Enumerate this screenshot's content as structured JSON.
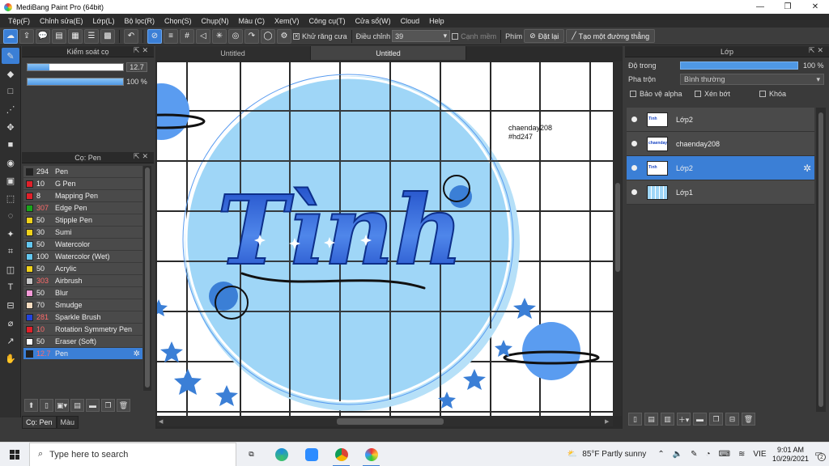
{
  "window": {
    "title": "MediBang Paint Pro (64bit)",
    "controls": [
      "—",
      "❐",
      "✕"
    ]
  },
  "menu": [
    "Tệp(F)",
    "Chỉnh sửa(E)",
    "Lớp(L)",
    "Bộ lọc(R)",
    "Chọn(S)",
    "Chụp(N)",
    "Màu (C)",
    "Xem(V)",
    "Công cụ(T)",
    "Cửa sổ(W)",
    "Cloud",
    "Help"
  ],
  "toolbar": {
    "antialias_label": "Khử răng cưa",
    "correction_label": "Điều chỉnh",
    "correction_value": "39",
    "smooth_edge_label": "Cạnh mềm",
    "key_label": "Phím",
    "reset_label": "Đặt lại",
    "straight_line_label": "Tạo một đường thẳng"
  },
  "brush_control": {
    "title": "Kiểm soát cọ",
    "size_value": "12.7",
    "size_fraction": 0.23,
    "opacity_value": "100 %",
    "opacity_fraction": 1.0
  },
  "brush_panel": {
    "title": "Cọ: Pen",
    "brushes": [
      {
        "size": "294",
        "name": "Pen",
        "color": "#222222",
        "size_red": false
      },
      {
        "size": "10",
        "name": "G Pen",
        "color": "#e0202a",
        "size_red": false
      },
      {
        "size": "8",
        "name": "Mapping Pen",
        "color": "#e0202a",
        "size_red": false
      },
      {
        "size": "307",
        "name": "Edge Pen",
        "color": "#1aa51a",
        "size_red": true
      },
      {
        "size": "50",
        "name": "Stipple Pen",
        "color": "#f0d21a",
        "size_red": false
      },
      {
        "size": "30",
        "name": "Sumi",
        "color": "#f0d21a",
        "size_red": false
      },
      {
        "size": "50",
        "name": "Watercolor",
        "color": "#63c7f0",
        "size_red": false
      },
      {
        "size": "100",
        "name": "Watercolor (Wet)",
        "color": "#63c7f0",
        "size_red": false
      },
      {
        "size": "50",
        "name": "Acrylic",
        "color": "#f0d21a",
        "size_red": false
      },
      {
        "size": "303",
        "name": "Airbrush",
        "color": "#c8c8c8",
        "size_red": true
      },
      {
        "size": "50",
        "name": "Blur",
        "color": "#f59ad8",
        "size_red": false
      },
      {
        "size": "70",
        "name": "Smudge",
        "color": "#f6dcc0",
        "size_red": false
      },
      {
        "size": "281",
        "name": "Sparkle Brush",
        "color": "#2244dd",
        "size_red": true
      },
      {
        "size": "10",
        "name": "Rotation Symmetry Pen",
        "color": "#e0202a",
        "size_red": true
      },
      {
        "size": "50",
        "name": "Eraser (Soft)",
        "color": "#ffffff",
        "size_red": false
      },
      {
        "size": "12.7",
        "name": "Pen",
        "color": "#222222",
        "size_red": true,
        "selected": true
      }
    ]
  },
  "bottom_tabs": [
    "Cọ: Pen",
    "Màu"
  ],
  "doc_tabs": [
    "Untitled",
    "Untitled"
  ],
  "canvas": {
    "lettering": "Tình",
    "caption_line1": "chaenday208",
    "caption_line2": "#hd247"
  },
  "layer_panel": {
    "title": "Lớp",
    "opacity_label": "Độ trong",
    "opacity_value": "100 %",
    "blend_label": "Pha trộn",
    "blend_value": "Bình thường",
    "protect_alpha": "Bảo vệ alpha",
    "clipping": "Xén bớt",
    "lock": "Khóa",
    "layers": [
      {
        "name": "Lớp2",
        "selected": false,
        "thumb_text": "Tình"
      },
      {
        "name": "chaenday208",
        "selected": false,
        "thumb_text": "chaenday208"
      },
      {
        "name": "Lớp2",
        "selected": true,
        "thumb_text": "Tình"
      },
      {
        "name": "Lớp1",
        "selected": false,
        "thumb_text": ""
      }
    ]
  },
  "taskbar": {
    "search_placeholder": "Type here to search",
    "weather": "85°F  Partly sunny",
    "language": "VIE",
    "time": "9:01 AM",
    "date": "10/29/2021",
    "notifications": "2"
  },
  "colors": {
    "accent": "#3b7fd6",
    "art_blue_light": "#9fd6f7",
    "art_blue": "#5a9cf0",
    "art_blue_dark": "#1c48c4"
  }
}
